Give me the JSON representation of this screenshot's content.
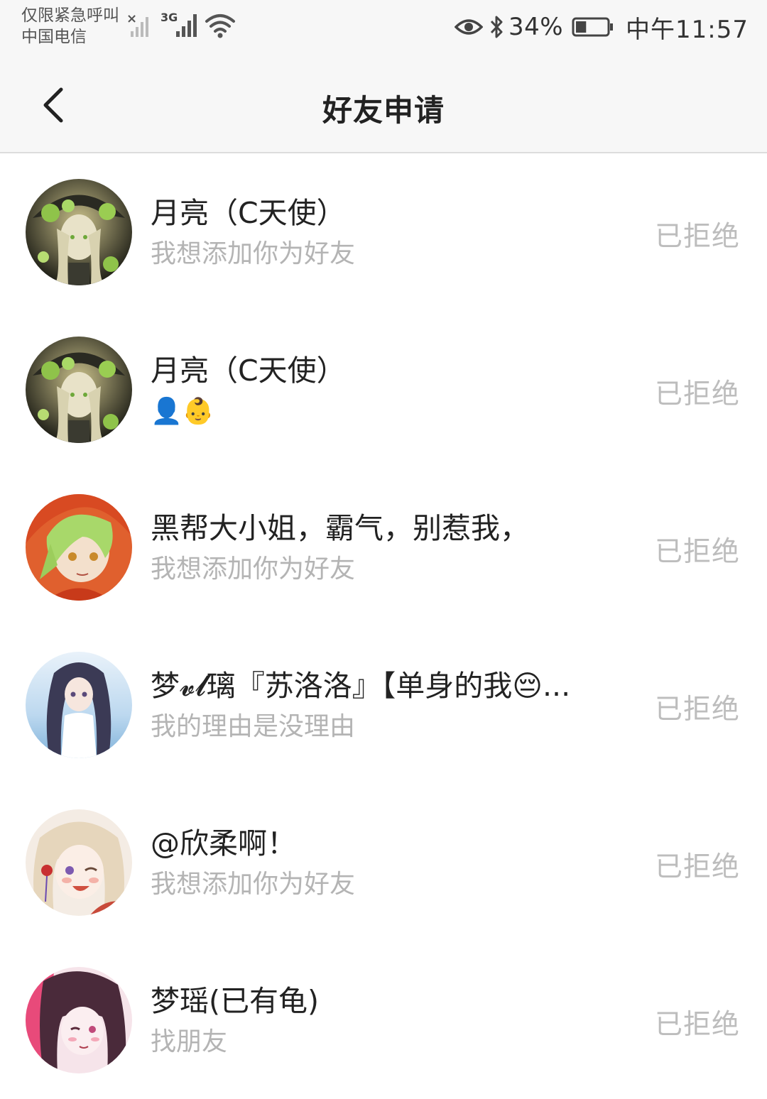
{
  "status_bar": {
    "carrier_line1": "仅限紧急呼叫",
    "carrier_line2": "中国电信",
    "network_type": "3G",
    "battery_percent": "34%",
    "battery_level": 0.34,
    "time": "中午11:57"
  },
  "header": {
    "title": "好友申请",
    "back_icon": "chevron-left-icon"
  },
  "requests": [
    {
      "name": "月亮（C天使）",
      "message": "我想添加你为好友",
      "status": "已拒绝",
      "avatar": "avatar-witch"
    },
    {
      "name": "月亮（C天使）",
      "message": "👤👶",
      "status": "已拒绝",
      "avatar": "avatar-witch"
    },
    {
      "name": "黑帮大小姐，霸气，别惹我，",
      "message": "我想添加你为好友",
      "status": "已拒绝",
      "avatar": "avatar-green-hair"
    },
    {
      "name": "梦𝓿𝓵璃『苏洛洛』【单身的我😔...",
      "message": "我的理由是没理由",
      "status": "已拒绝",
      "avatar": "avatar-sea-girl"
    },
    {
      "name": "@欣柔啊！",
      "message": "我想添加你为好友",
      "status": "已拒绝",
      "avatar": "avatar-blonde-girl"
    },
    {
      "name": "梦瑶(已有龟)",
      "message": "找朋友",
      "status": "已拒绝",
      "avatar": "avatar-pink-girl"
    }
  ],
  "colors": {
    "status_text": "#bdbdbd",
    "message_text": "#b4b4b4",
    "name_text": "#222222",
    "header_bg": "#f7f7f7"
  }
}
